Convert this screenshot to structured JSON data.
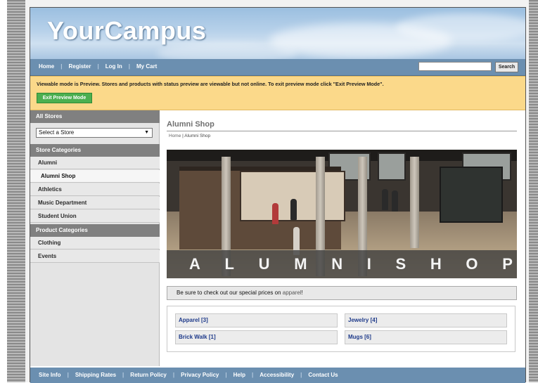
{
  "header": {
    "logo": "YourCampus"
  },
  "nav": {
    "items": [
      "Home",
      "Register",
      "Log In",
      "My Cart"
    ],
    "search_value": "",
    "search_button": "Search"
  },
  "notice": {
    "message": "Viewable mode is Preview. Stores and products with status preview are viewable but not online. To exit preview mode click \"Exit Preview Mode\".",
    "exit_button": "Exit Preview Mode"
  },
  "sidebar": {
    "all_stores_heading": "All Stores",
    "store_select": "Select a Store",
    "store_categories_heading": "Store Categories",
    "store_categories": [
      "Alumni",
      "Alumni Shop",
      "Athletics",
      "Music Department",
      "Student Union"
    ],
    "product_categories_heading": "Product Categories",
    "product_categories": [
      "Clothing",
      "Events"
    ]
  },
  "main": {
    "title": "Alumni Shop",
    "breadcrumb_home": "Home",
    "breadcrumb_sep": " | ",
    "breadcrumb_current": "Alumni Shop",
    "hero_letters": [
      "A",
      "L",
      "U",
      "M",
      "N",
      "I",
      "S",
      "H",
      "O",
      "P"
    ],
    "promo_prefix": "Be sure to check out our special prices on ",
    "promo_link": "apparel",
    "promo_suffix": "!",
    "categories": [
      "Apparel [3]",
      "Jewelry [4]",
      "Brick Walk [1]",
      "Mugs [6]"
    ]
  },
  "footer": {
    "items": [
      "Site Info",
      "Shipping Rates",
      "Return Policy",
      "Privacy Policy",
      "Help",
      "Accessibility",
      "Contact Us"
    ]
  }
}
